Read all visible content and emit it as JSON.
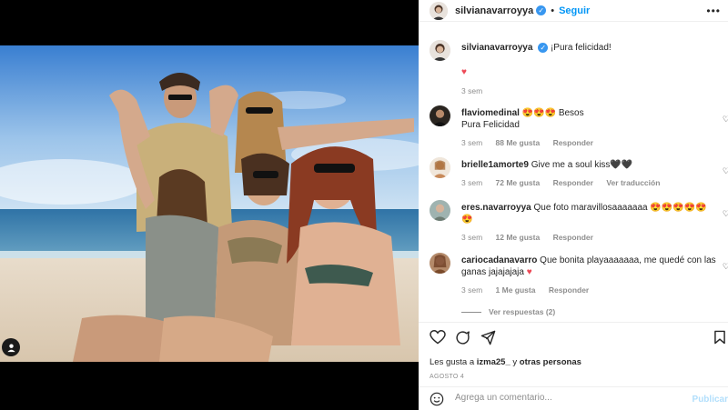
{
  "post": {
    "author": "silvianavarroyya",
    "follow_label": "Seguir",
    "dot": "•",
    "more": "•••"
  },
  "caption": {
    "author": "silvianavarroyya",
    "text": "¡Pura felicidad!",
    "emoji": "♥",
    "time": "3 sem"
  },
  "comments": [
    {
      "user": "flaviomedinal",
      "text": "😍😍😍 Besos",
      "text2": "Pura Felicidad",
      "time": "3 sem",
      "likes": "88 Me gusta",
      "action": "Responder"
    },
    {
      "user": "brielle1amorte9",
      "text": "Give me a soul kiss🖤🖤",
      "time": "3 sem",
      "likes": "72 Me gusta",
      "action": "Responder",
      "translate": "Ver traducción"
    },
    {
      "user": "eres.navarroyya",
      "text": "Que foto maravillosaaaaaaa 😍😍😍😍😍",
      "text2": "😍",
      "time": "3 sem",
      "likes": "12 Me gusta",
      "action": "Responder"
    },
    {
      "user": "cariocadanavarro",
      "text": "Que bonita playaaaaaaa, me quedé con las",
      "text2": "ganas jajajajaja",
      "heart": "♥",
      "time": "3 sem",
      "likes": "1 Me gusta",
      "action": "Responder"
    }
  ],
  "view_replies": "Ver respuestas (2)",
  "likes": {
    "prefix": "Les gusta a",
    "user": "izma25_",
    "joiner": "y",
    "others": "otras personas"
  },
  "date": "AGOSTO 4",
  "add_comment": {
    "placeholder": "Agrega un comentario...",
    "publish": "Publicar"
  },
  "colors": {
    "accent": "#0095f6",
    "verified": "#3897f0",
    "heart": "#ed4956",
    "muted": "#8e8e8e"
  }
}
